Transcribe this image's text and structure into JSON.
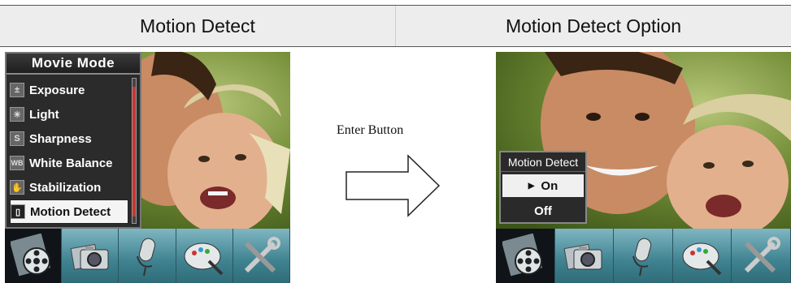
{
  "header": {
    "left_title": "Motion Detect",
    "right_title": "Motion Detect Option"
  },
  "left_screen": {
    "menu_title": "Movie Mode",
    "menu_items": [
      {
        "label": "Exposure",
        "icon": "exposure-icon",
        "glyph": "±"
      },
      {
        "label": "Light",
        "icon": "light-icon",
        "glyph": "☀"
      },
      {
        "label": "Sharpness",
        "icon": "sharpness-icon",
        "glyph": "S"
      },
      {
        "label": "White Balance",
        "icon": "white-balance-icon",
        "glyph": "WB"
      },
      {
        "label": "Stabilization",
        "icon": "stabilization-icon",
        "glyph": "✋"
      },
      {
        "label": "Motion Detect",
        "icon": "motion-detect-icon",
        "glyph": "▯"
      }
    ],
    "selected_item": "Motion Detect"
  },
  "middle": {
    "enter_label": "Enter Button"
  },
  "right_screen": {
    "popup_title": "Motion Detect",
    "options": [
      {
        "label": "On",
        "selected": true
      },
      {
        "label": "Off",
        "selected": false
      }
    ]
  },
  "iconbar": {
    "icons": [
      "movie-mode-icon",
      "camera-mode-icon",
      "voice-mode-icon",
      "playback-mode-icon",
      "setup-mode-icon"
    ],
    "active_index": 0
  },
  "colors": {
    "menu_bg": "#2b2b2b",
    "selection_bg": "#f4f4f4",
    "iconbar_accent": "#3f8290"
  }
}
